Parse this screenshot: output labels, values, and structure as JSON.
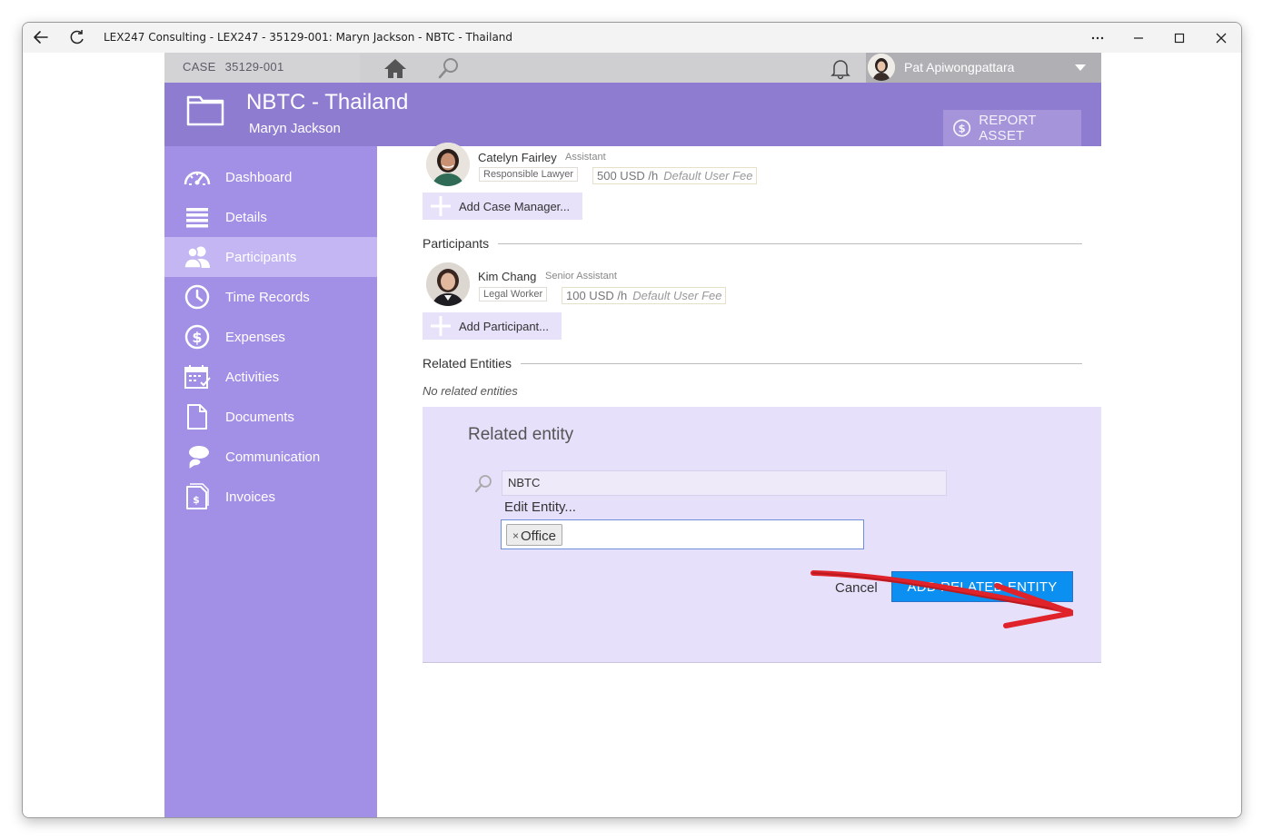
{
  "window": {
    "title": "LEX247 Consulting - LEX247 - 35129-001: Maryn Jackson - NBTC - Thailand",
    "controls": [
      "more-icon",
      "minimize-icon",
      "maximize-icon",
      "close-icon"
    ]
  },
  "topbar": {
    "case_label": "CASE",
    "case_number": "35129-001",
    "user_name": "Pat Apiwongpattara"
  },
  "header": {
    "title": "NBTC - Thailand",
    "subtitle": "Maryn Jackson",
    "report_button": "REPORT ASSET"
  },
  "sidebar": {
    "items": [
      {
        "label": "Dashboard",
        "icon": "dashboard-icon"
      },
      {
        "label": "Details",
        "icon": "details-icon"
      },
      {
        "label": "Participants",
        "icon": "participants-icon",
        "active": true
      },
      {
        "label": "Time Records",
        "icon": "clock-icon"
      },
      {
        "label": "Expenses",
        "icon": "dollar-icon"
      },
      {
        "label": "Activities",
        "icon": "calendar-icon"
      },
      {
        "label": "Documents",
        "icon": "document-icon"
      },
      {
        "label": "Communication",
        "icon": "chat-icon"
      },
      {
        "label": "Invoices",
        "icon": "invoice-icon"
      }
    ]
  },
  "case_manager": {
    "name": "Catelyn Fairley",
    "role": "Assistant",
    "tag": "Responsible Lawyer",
    "fee": "500 USD /h",
    "fee_note": "Default User Fee",
    "add_label": "Add Case Manager..."
  },
  "participants": {
    "heading": "Participants",
    "name": "Kim Chang",
    "role": "Senior Assistant",
    "tag": "Legal Worker",
    "fee": "100 USD /h",
    "fee_note": "Default User Fee",
    "add_label": "Add Participant..."
  },
  "related": {
    "heading": "Related Entities",
    "empty": "No related entities"
  },
  "related_form": {
    "title": "Related entity",
    "search_value": "NBTC",
    "edit_link": "Edit Entity...",
    "tag_label": "Office",
    "cancel": "Cancel",
    "submit": "ADD RELATED ENTITY"
  },
  "colors": {
    "header": "#8e7cd0",
    "sidebar": "#a28fe6",
    "sidebar_active": "#c3b6f2",
    "panel": "#e6e0fb",
    "primary_button": "#0b8ff0",
    "annotation_arrow": "#e0232a"
  }
}
